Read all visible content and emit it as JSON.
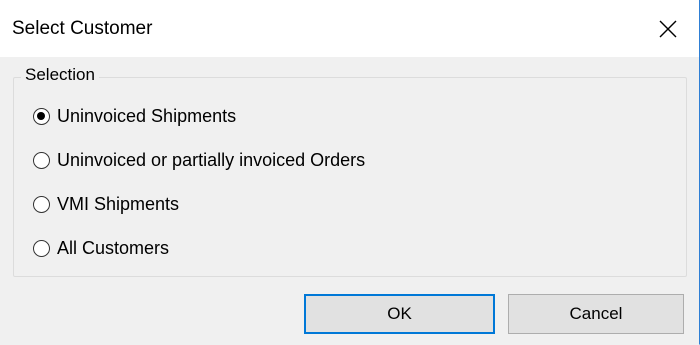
{
  "window": {
    "title": "Select Customer",
    "close_icon": "close-icon"
  },
  "selection_group": {
    "legend": "Selection",
    "options": [
      {
        "label": "Uninvoiced Shipments",
        "checked": true
      },
      {
        "label": "Uninvoiced or partially invoiced Orders",
        "checked": false
      },
      {
        "label": "VMI Shipments",
        "checked": false
      },
      {
        "label": "All Customers",
        "checked": false
      }
    ]
  },
  "buttons": {
    "ok_label": "OK",
    "cancel_label": "Cancel"
  },
  "colors": {
    "accent": "#0078d7",
    "dialog_background": "#f0f0f0",
    "titlebar_background": "#ffffff"
  }
}
